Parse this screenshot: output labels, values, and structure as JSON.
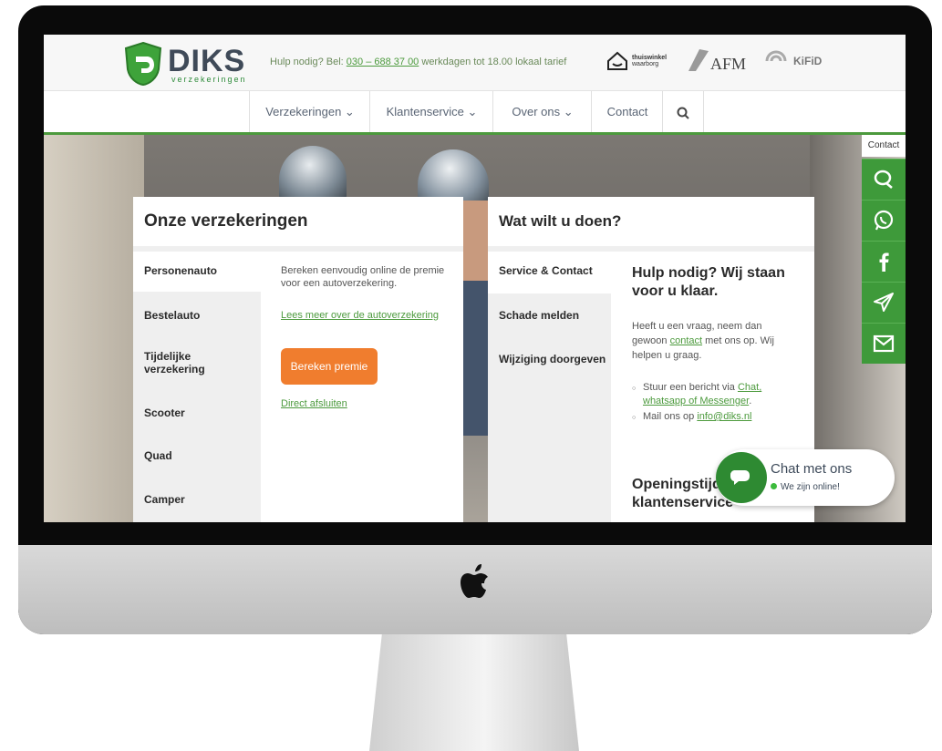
{
  "logo": {
    "word": "DIKS",
    "sub": "verzekeringen"
  },
  "header": {
    "help_prefix": "Hulp nodig? Bel: ",
    "phone": "030 – 688 37 00",
    "help_suffix": " werkdagen tot 18.00 lokaal tarief",
    "badges": {
      "thuis_line1": "thuiswinkel",
      "thuis_line2": "waarborg",
      "afm": "AFM",
      "kifid": "KiFiD"
    }
  },
  "nav": {
    "items": [
      "Verzekeringen ⌄",
      "Klantenservice ⌄",
      "Over ons ⌄",
      "Contact"
    ],
    "search_icon": "search-icon"
  },
  "insurance_panel": {
    "title": "Onze verzekeringen",
    "items": [
      "Personenauto",
      "Bestelauto",
      "Tijdelijke verzekering",
      "Scooter",
      "Quad",
      "Camper"
    ],
    "description": "Bereken eenvoudig online de premie voor een autoverzekering.",
    "read_more": "Lees meer over de autoverzekering",
    "calc_button": "Bereken premie",
    "direct_link": "Direct afsluiten"
  },
  "action_panel": {
    "title": "Wat wilt u doen?",
    "items": [
      "Service & Contact",
      "Schade melden",
      "Wijziging doorgeven"
    ],
    "help_title": "Hulp nodig? Wij staan voor u klaar.",
    "help_text_1": "Heeft u een vraag, neem dan gewoon ",
    "help_link": "contact",
    "help_text_2": " met ons op. Wij helpen u graag.",
    "bullet_1_prefix": "Stuur een bericht via ",
    "bullet_1_link": "Chat, whatsapp of Messenger",
    "bullet_1_suffix": ".",
    "bullet_2_prefix": "Mail ons op ",
    "bullet_2_link": "info@diks.nl",
    "open_title": "Openingstijden klantenservice"
  },
  "side_contact": {
    "label": "Contact",
    "icons": [
      "chat-icon",
      "whatsapp-icon",
      "facebook-icon",
      "send-icon",
      "mail-icon"
    ],
    "accent": "#3e9a3a"
  },
  "chat_widget": {
    "title": "Chat met ons",
    "status": "We zijn online!"
  },
  "colors": {
    "brand_green": "#4c9a3d",
    "cta_orange": "#f07d2e"
  }
}
